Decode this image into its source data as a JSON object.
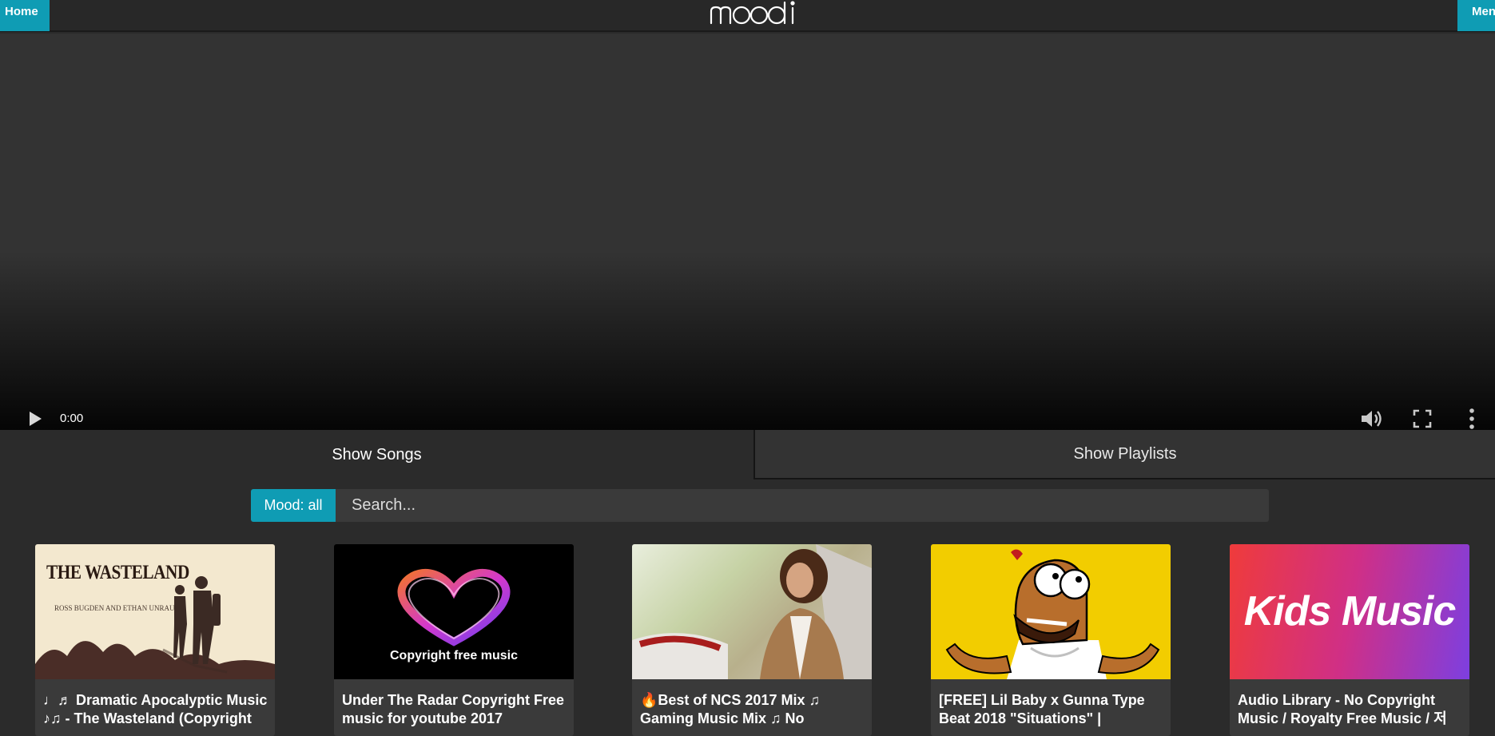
{
  "topbar": {
    "home_label": "Home",
    "menu_label": "Menu",
    "logo_text": "mood"
  },
  "player": {
    "time": "0:00",
    "progress": 0
  },
  "tabs": [
    {
      "label": "Show Songs",
      "active": true
    },
    {
      "label": "Show Playlists",
      "active": false
    }
  ],
  "search": {
    "mood_label": "Mood: all",
    "placeholder": "Search..."
  },
  "songs": [
    {
      "title": "♩♬ Dramatic Apocalyptic Music ♪♫ - The Wasteland (Copyright",
      "thumb_title": "THE WASTELAND",
      "thumb_sub": "ROSS BUGDEN AND ETHAN UNRAU"
    },
    {
      "title": "Under The Radar Copyright Free music for youtube 2017",
      "thumb_text": "Copyright free music"
    },
    {
      "title": "🔥Best of NCS 2017 Mix ♫ Gaming Music Mix ♫ No"
    },
    {
      "title": "[FREE] Lil Baby x Gunna Type Beat 2018 \"Situations\" |"
    },
    {
      "title": "Audio Library - No Copyright Music / Royalty Free Music / 저",
      "thumb_text": "Kids Music"
    }
  ],
  "colors": {
    "accent": "#0f9cb4",
    "background": "#2b2b2b",
    "card": "#3a3a3a"
  }
}
